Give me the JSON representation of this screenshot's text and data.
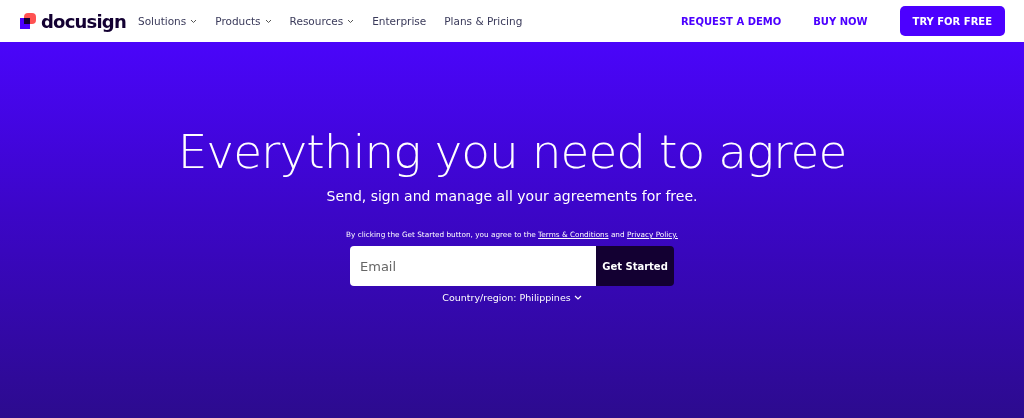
{
  "header": {
    "logo": "docusign",
    "nav": [
      {
        "label": "Solutions",
        "has_menu": true
      },
      {
        "label": "Products",
        "has_menu": true
      },
      {
        "label": "Resources",
        "has_menu": true
      },
      {
        "label": "Enterprise",
        "has_menu": false
      },
      {
        "label": "Plans & Pricing",
        "has_menu": false
      }
    ],
    "actions": [
      {
        "label": "REQUEST A DEMO",
        "kind": "link"
      },
      {
        "label": "BUY NOW",
        "kind": "link"
      },
      {
        "label": "TRY FOR FREE",
        "kind": "primary"
      }
    ]
  },
  "hero": {
    "title": "Everything you need to agree",
    "subtitle": "Send, sign and manage all your agreements for free.",
    "consent": [
      {
        "text": "By clicking the Get Started button, you agree to the ",
        "kind": "text"
      },
      {
        "text": "Terms & Conditions",
        "kind": "link"
      },
      {
        "text": " and ",
        "kind": "text"
      },
      {
        "text": "Privacy Policy.",
        "kind": "link"
      }
    ],
    "email": {
      "placeholder": "Email"
    },
    "submit": "Get Started",
    "country": "Country/region: Philippines"
  }
}
